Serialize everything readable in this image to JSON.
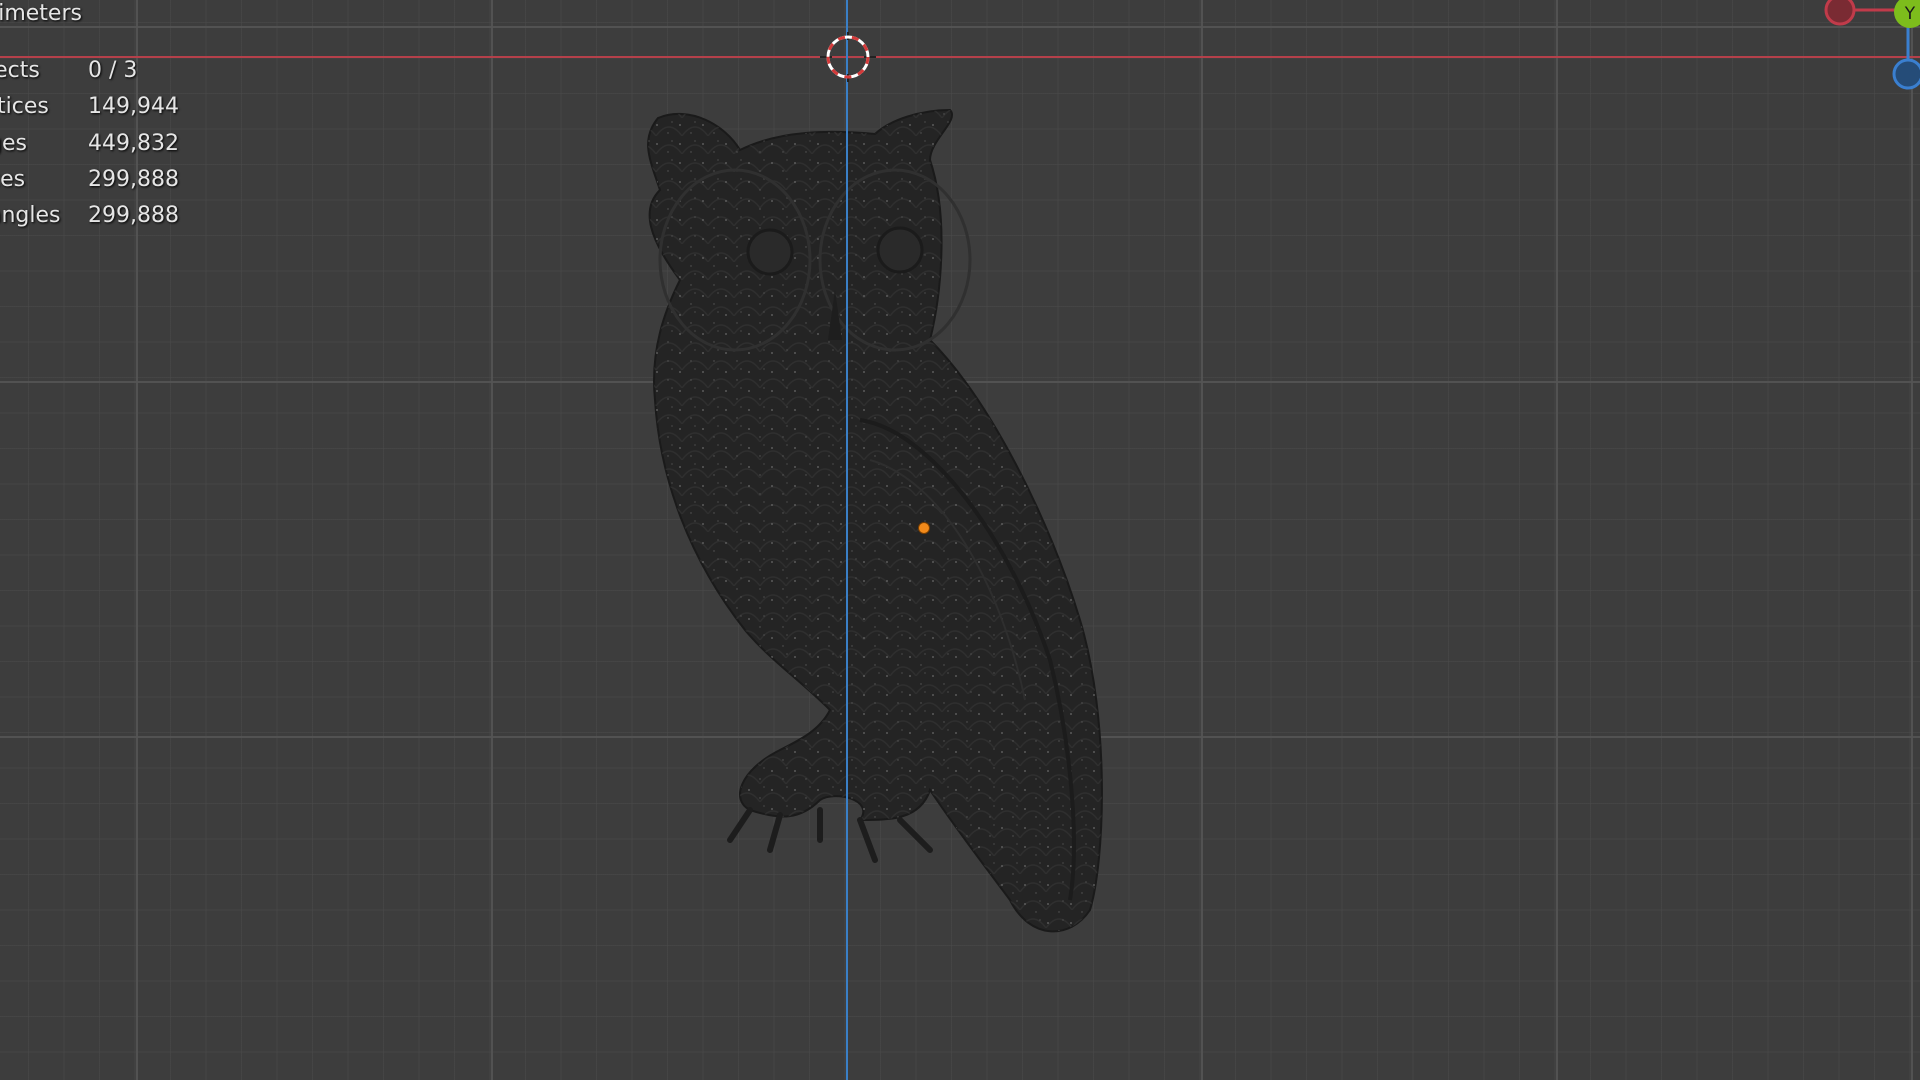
{
  "viewport": {
    "unit_label": "llimeters",
    "stats": [
      {
        "label": "jects",
        "value": "0 / 3"
      },
      {
        "label": "rtices",
        "value": "149,944"
      },
      {
        "label": "ges",
        "value": "449,832"
      },
      {
        "label": "ces",
        "value": "299,888"
      },
      {
        "label": "angles",
        "value": "299,888"
      }
    ]
  },
  "gizmo": {
    "x_color": "#c13b4a",
    "y_color": "#7dbd1c",
    "z_color": "#3a7fd0",
    "y_axis_letter": "Y"
  },
  "colors": {
    "background": "#3d3d3d",
    "x_axis": "#b5404a",
    "z_axis": "#3a7fc6",
    "origin": "#f28a1a",
    "mesh": "#242424"
  }
}
